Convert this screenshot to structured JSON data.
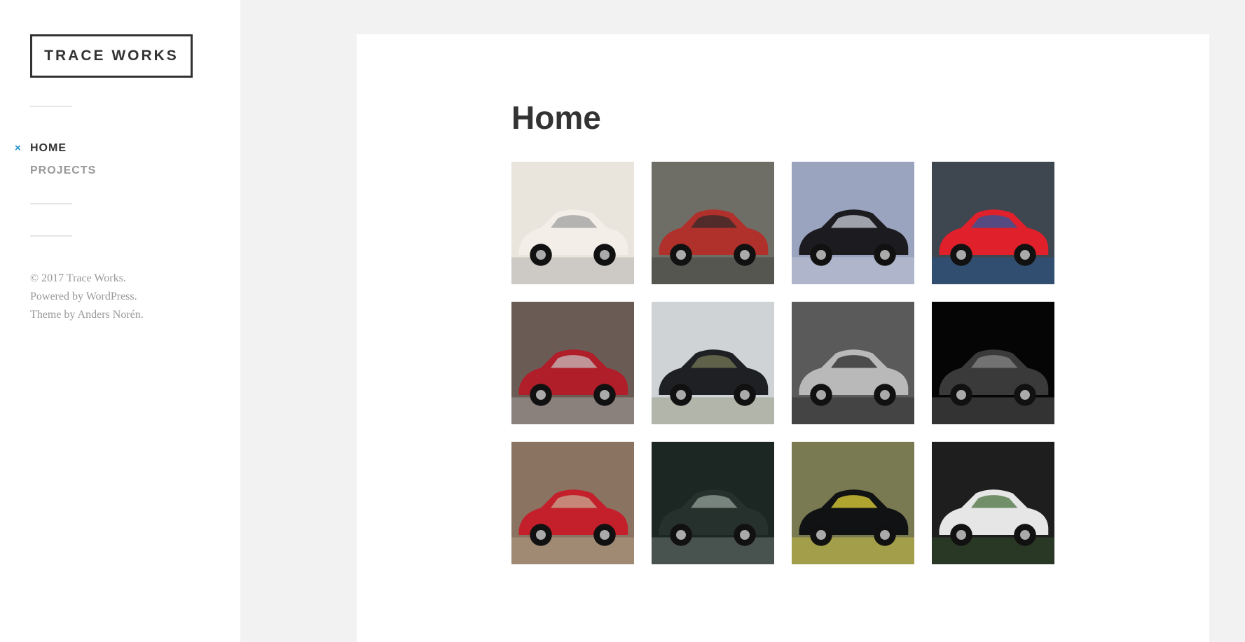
{
  "site": {
    "title": "TRACE WORKS"
  },
  "nav": {
    "items": [
      {
        "label": "HOME",
        "active": true
      },
      {
        "label": "PROJECTS",
        "active": false
      }
    ],
    "active_mark": "×",
    "accent_color": "#1a8ecf"
  },
  "footer": {
    "copyright_prefix": "© 2017 ",
    "copyright_link": "Trace Works",
    "copyright_suffix": ".",
    "powered_prefix": "Powered by ",
    "powered_link": "WordPress",
    "powered_suffix": ".",
    "theme_prefix": "Theme by ",
    "theme_link": "Anders Norén",
    "theme_suffix": "."
  },
  "main": {
    "title": "Home",
    "gallery": [
      {
        "subject": "cream classic car front",
        "bg": "#e9e4dc",
        "body": "#f3efe8",
        "accent": "#9a9a9a"
      },
      {
        "subject": "red muscle car in garage",
        "bg": "#6e6e66",
        "body": "#b0312c",
        "accent": "#2a2a2a"
      },
      {
        "subject": "black mustang under clouds",
        "bg": "#9aa4bf",
        "body": "#1c1c20",
        "accent": "#d7dbe6"
      },
      {
        "subject": "red ferrari in front of building",
        "bg": "#3e4650",
        "body": "#e0202a",
        "accent": "#1a5ca8"
      },
      {
        "subject": "red classic chevrolet",
        "bg": "#6b5b55",
        "body": "#b01e2a",
        "accent": "#c7c7c7"
      },
      {
        "subject": "black mercedes sl front",
        "bg": "#cfd3d6",
        "body": "#1e2024",
        "accent": "#7b7f58"
      },
      {
        "subject": "black and white sports car wheel",
        "bg": "#5a5a5a",
        "body": "#b9b9b9",
        "accent": "#1c1c1c"
      },
      {
        "subject": "black bentley on dark background",
        "bg": "#050505",
        "body": "#3a3a3a",
        "accent": "#8a8a8a"
      },
      {
        "subject": "red alfa romeo driving",
        "bg": "#8a7360",
        "body": "#c4202b",
        "accent": "#c8b49a"
      },
      {
        "subject": "black mercedes hood close-up",
        "bg": "#1c2622",
        "body": "#26302c",
        "accent": "#9aa6a0"
      },
      {
        "subject": "black convertible rear",
        "bg": "#7a7a52",
        "body": "#101214",
        "accent": "#f2e23a"
      },
      {
        "subject": "white corvette on dark background",
        "bg": "#1e1e1e",
        "body": "#e6e6e6",
        "accent": "#3f6a33"
      }
    ]
  }
}
